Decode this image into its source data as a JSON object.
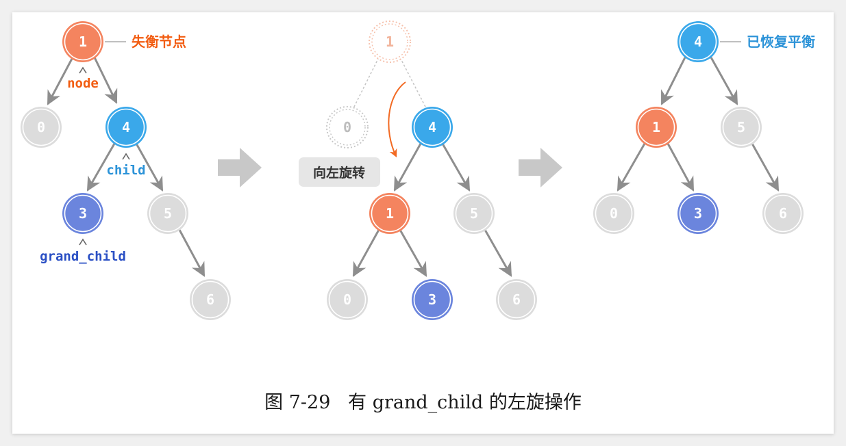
{
  "caption": {
    "figure_number": "图 7-29",
    "title": "有 grand_child 的左旋操作"
  },
  "colors": {
    "orange": "#f4845f",
    "blue": "#3aa8ea",
    "indigo": "#6b85dd",
    "gray": "#dcdcdc",
    "edge": "#8e8e8e",
    "label_orange": "#f25d12",
    "label_blue": "#2c93d8",
    "label_indigo": "#2a4fc4",
    "rotate_arrow": "#f26a23"
  },
  "panels": {
    "before": {
      "nodes": [
        {
          "id": "n1",
          "key": "1",
          "color": "orange"
        },
        {
          "id": "n0",
          "key": "0",
          "color": "gray"
        },
        {
          "id": "n4",
          "key": "4",
          "color": "blue"
        },
        {
          "id": "n3",
          "key": "3",
          "color": "indigo"
        },
        {
          "id": "n5",
          "key": "5",
          "color": "gray"
        },
        {
          "id": "n6",
          "key": "6",
          "color": "gray"
        }
      ],
      "labels": {
        "unbalanced": "失衡节点",
        "node": "node",
        "child": "child",
        "grand_child": "grand_child"
      }
    },
    "middle": {
      "nodes": [
        {
          "id": "m1g",
          "key": "1",
          "color": "ghost"
        },
        {
          "id": "m0g",
          "key": "0",
          "color": "ghost"
        },
        {
          "id": "m4",
          "key": "4",
          "color": "blue"
        },
        {
          "id": "m1",
          "key": "1",
          "color": "orange"
        },
        {
          "id": "m5",
          "key": "5",
          "color": "gray"
        },
        {
          "id": "m0",
          "key": "0",
          "color": "gray"
        },
        {
          "id": "m3",
          "key": "3",
          "color": "indigo"
        },
        {
          "id": "m6",
          "key": "6",
          "color": "gray"
        }
      ],
      "labels": {
        "rotate": "向左旋转"
      }
    },
    "after": {
      "nodes": [
        {
          "id": "a4",
          "key": "4",
          "color": "blue"
        },
        {
          "id": "a1",
          "key": "1",
          "color": "orange"
        },
        {
          "id": "a5",
          "key": "5",
          "color": "gray"
        },
        {
          "id": "a0",
          "key": "0",
          "color": "gray"
        },
        {
          "id": "a3",
          "key": "3",
          "color": "indigo"
        },
        {
          "id": "a6",
          "key": "6",
          "color": "gray"
        }
      ],
      "labels": {
        "balanced": "已恢复平衡"
      }
    }
  }
}
